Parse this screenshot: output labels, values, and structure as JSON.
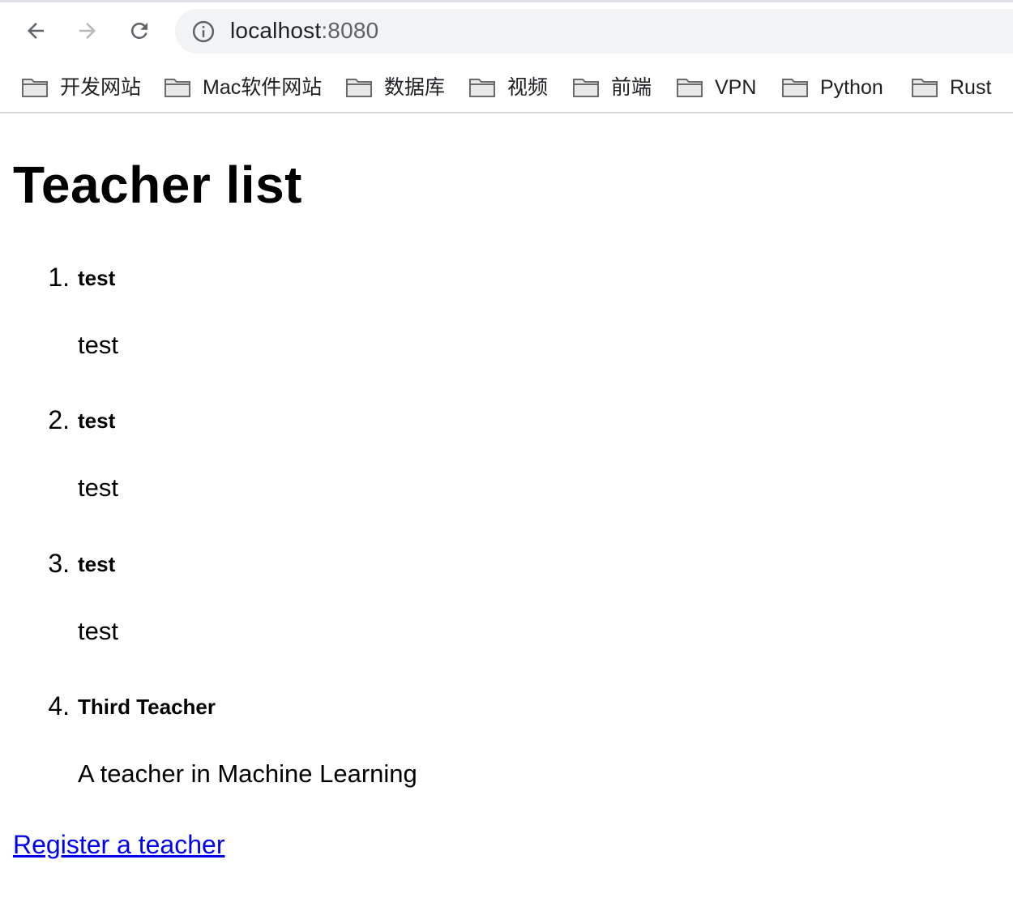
{
  "browser": {
    "nav": {
      "back_icon": "arrow-left-icon",
      "forward_icon": "arrow-right-icon",
      "reload_icon": "reload-icon",
      "forward_enabled": false
    },
    "address_bar": {
      "icon": "info-icon",
      "host": "localhost",
      "port": ":8080"
    },
    "bookmarks": [
      {
        "label": "开发网站",
        "icon": "folder-icon"
      },
      {
        "label": "Mac软件网站",
        "icon": "folder-icon"
      },
      {
        "label": "数据库",
        "icon": "folder-icon"
      },
      {
        "label": "视频",
        "icon": "folder-icon"
      },
      {
        "label": "前端",
        "icon": "folder-icon"
      },
      {
        "label": "VPN",
        "icon": "folder-icon"
      },
      {
        "label": "Python",
        "icon": "folder-icon"
      },
      {
        "label": "Rust",
        "icon": "folder-icon"
      }
    ]
  },
  "page": {
    "title": "Teacher list",
    "teachers": [
      {
        "number": "1.",
        "name": "test",
        "description": "test"
      },
      {
        "number": "2.",
        "name": "test",
        "description": "test"
      },
      {
        "number": "3.",
        "name": "test",
        "description": "test"
      },
      {
        "number": "4.",
        "name": "Third Teacher",
        "description": "A teacher in Machine Learning"
      }
    ],
    "register_link": "Register a teacher"
  },
  "colors": {
    "link": "#0000ee",
    "omnibox_bg": "#f1f3f4",
    "chrome_icon": "#5f6368",
    "chrome_icon_disabled": "#b5b7ba"
  }
}
